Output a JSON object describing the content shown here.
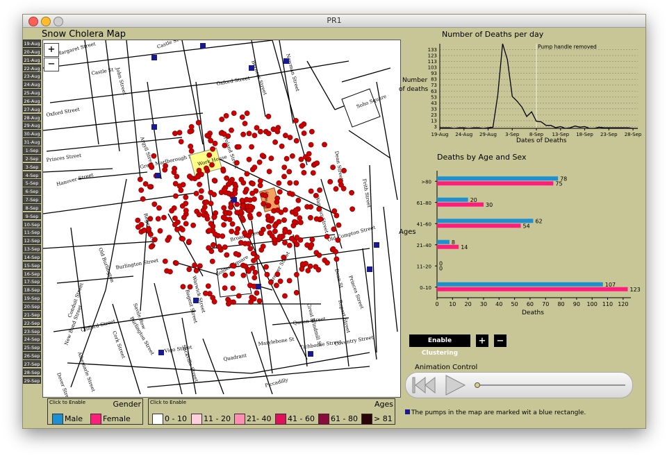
{
  "window": {
    "title": "PR1"
  },
  "app_title": "Snow Cholera Map",
  "dates": [
    "19-Aug",
    "20-Aug",
    "21-Aug",
    "22-Aug",
    "23-Aug",
    "24-Aug",
    "25-Aug",
    "26-Aug",
    "27-Aug",
    "28-Aug",
    "29-Aug",
    "30-Aug",
    "31-Aug",
    "1-Sep",
    "2-Sep",
    "3-Sep",
    "4-Sep",
    "5-Sep",
    "6-Sep",
    "7-Sep",
    "8-Sep",
    "9-Sep",
    "10-Sep",
    "11-Sep",
    "12-Sep",
    "13-Sep",
    "14-Sep",
    "15-Sep",
    "16-Sep",
    "17-Sep",
    "18-Sep",
    "19-Sep",
    "20-Sep",
    "21-Sep",
    "22-Sep",
    "23-Sep",
    "24-Sep",
    "25-Sep",
    "26-Sep",
    "27-Sep",
    "28-Sep",
    "29-Sep"
  ],
  "map": {
    "zoom_in": "+",
    "zoom_out": "−",
    "streets": [
      "Margaret Street",
      "John Street",
      "Castle St East",
      "Oxford Street",
      "Berners Street",
      "Newman Street",
      "Castle St",
      "Wardour Street",
      "Soho Square",
      "Dean Street",
      "Frith Street",
      "Princes Street",
      "Argyll Street",
      "Great Marlborough Street",
      "Hanover Street",
      "Poland Street",
      "Broad Street",
      "Work House",
      "Brewery",
      "Old Compton Street",
      "Regent Street",
      "Conduit Street",
      "Golden Square",
      "Brewer Street",
      "Rupert Street",
      "Princes Street",
      "Queen Street",
      "Marylebone St",
      "Tichborne Street",
      "Coventry Street",
      "Quadrant",
      "Piccadilly",
      "Sackville Street",
      "Vigo Street",
      "Burlington Street",
      "Old Burlington",
      "New Bond Street",
      "Albemarle Street",
      "Dover Street",
      "Clifford Street",
      "Cork Street",
      "Savile Row",
      "Warwick Street",
      "Great Windmill St",
      "Dean St",
      "Regent Street"
    ],
    "workhouse_label": "Work House",
    "brewery_label": "Brewery"
  },
  "colors": {
    "pump": "#1a1a8f",
    "death": "#cc0000",
    "male": "#1e90d0",
    "female": "#ff1f7a",
    "chart_line": "#000000",
    "panel": "#c8c596"
  },
  "deaths_per_day": {
    "title": "Number of Deaths per day",
    "ylabel_lines": [
      "Number",
      "of deaths"
    ],
    "xlabel": "Dates of Deaths",
    "annotation": "Pump handle removed",
    "x_ticks": [
      "19-Aug",
      "24-Aug",
      "29-Aug",
      "3-Sep",
      "8-Sep",
      "13-Sep",
      "18-Sep",
      "23-Sep",
      "28-Sep"
    ],
    "y_ticks": [
      "3",
      "13",
      "23",
      "33",
      "43",
      "53",
      "63",
      "73",
      "83",
      "93",
      "103",
      "113",
      "123",
      "133"
    ]
  },
  "age_sex": {
    "title": "Deaths by Age and Sex",
    "ylabel": "Ages",
    "xlabel": "Deaths",
    "x_ticks": [
      "0",
      "10",
      "20",
      "30",
      "40",
      "50",
      "60",
      "70",
      "80",
      "90",
      "100",
      "110",
      "120"
    ]
  },
  "chart_data": [
    {
      "type": "line",
      "title": "Number of Deaths per day",
      "xlabel": "Dates of Deaths",
      "ylabel": "Number of deaths",
      "x": [
        "19-Aug",
        "20-Aug",
        "21-Aug",
        "22-Aug",
        "23-Aug",
        "24-Aug",
        "25-Aug",
        "26-Aug",
        "27-Aug",
        "28-Aug",
        "29-Aug",
        "30-Aug",
        "31-Aug",
        "1-Sep",
        "2-Sep",
        "3-Sep",
        "4-Sep",
        "5-Sep",
        "6-Sep",
        "7-Sep",
        "8-Sep",
        "9-Sep",
        "10-Sep",
        "11-Sep",
        "12-Sep",
        "13-Sep",
        "14-Sep",
        "15-Sep",
        "16-Sep",
        "17-Sep",
        "18-Sep",
        "19-Sep",
        "20-Sep",
        "21-Sep",
        "22-Sep",
        "23-Sep",
        "24-Sep",
        "25-Sep",
        "26-Sep",
        "27-Sep",
        "28-Sep",
        "29-Sep"
      ],
      "values": [
        1,
        1,
        1,
        0,
        1,
        1,
        0,
        1,
        1,
        0,
        1,
        2,
        56,
        143,
        116,
        54,
        46,
        36,
        20,
        28,
        12,
        11,
        5,
        5,
        1,
        3,
        0,
        1,
        4,
        2,
        3,
        0,
        0,
        2,
        1,
        1,
        1,
        1,
        1,
        1,
        0,
        0
      ],
      "ylim": [
        0,
        143
      ],
      "annotations": [
        {
          "x": "8-Sep",
          "text": "Pump handle removed"
        }
      ],
      "grid": true
    },
    {
      "type": "bar",
      "orientation": "horizontal",
      "title": "Deaths by Age and Sex",
      "xlabel": "Deaths",
      "ylabel": "Ages",
      "categories": [
        ">80",
        "61–80",
        "41–60",
        "21–40",
        "11–20",
        "0–10"
      ],
      "series": [
        {
          "name": "Male",
          "values": [
            78,
            20,
            62,
            8,
            0,
            107
          ]
        },
        {
          "name": "Female",
          "values": [
            75,
            30,
            54,
            14,
            0,
            123
          ]
        }
      ],
      "xlim": [
        0,
        125
      ]
    }
  ],
  "controls": {
    "enable_clustering": "Enable Clustering",
    "plus": "+",
    "minus": "−",
    "animation_label": "Animation Control"
  },
  "gender_legend": {
    "hint": "Click to Enable",
    "title": "Gender",
    "items": [
      {
        "label": "Male",
        "color": "#1e90d0"
      },
      {
        "label": "Female",
        "color": "#ff1f7a"
      }
    ]
  },
  "age_legend": {
    "hint": "Click to Enable",
    "title": "Ages",
    "items": [
      {
        "label": "0 - 10",
        "color": "#ffffff"
      },
      {
        "label": "11 - 20",
        "color": "#ffd0dc"
      },
      {
        "label": "21- 40",
        "color": "#ff8fb0"
      },
      {
        "label": "41 - 60",
        "color": "#e0105a"
      },
      {
        "label": "61 - 80",
        "color": "#8a0c3a"
      },
      {
        "label": "> 81",
        "color": "#2a0408"
      }
    ]
  },
  "pump_note": "The pumps in the map are marked wit a blue rectangle."
}
